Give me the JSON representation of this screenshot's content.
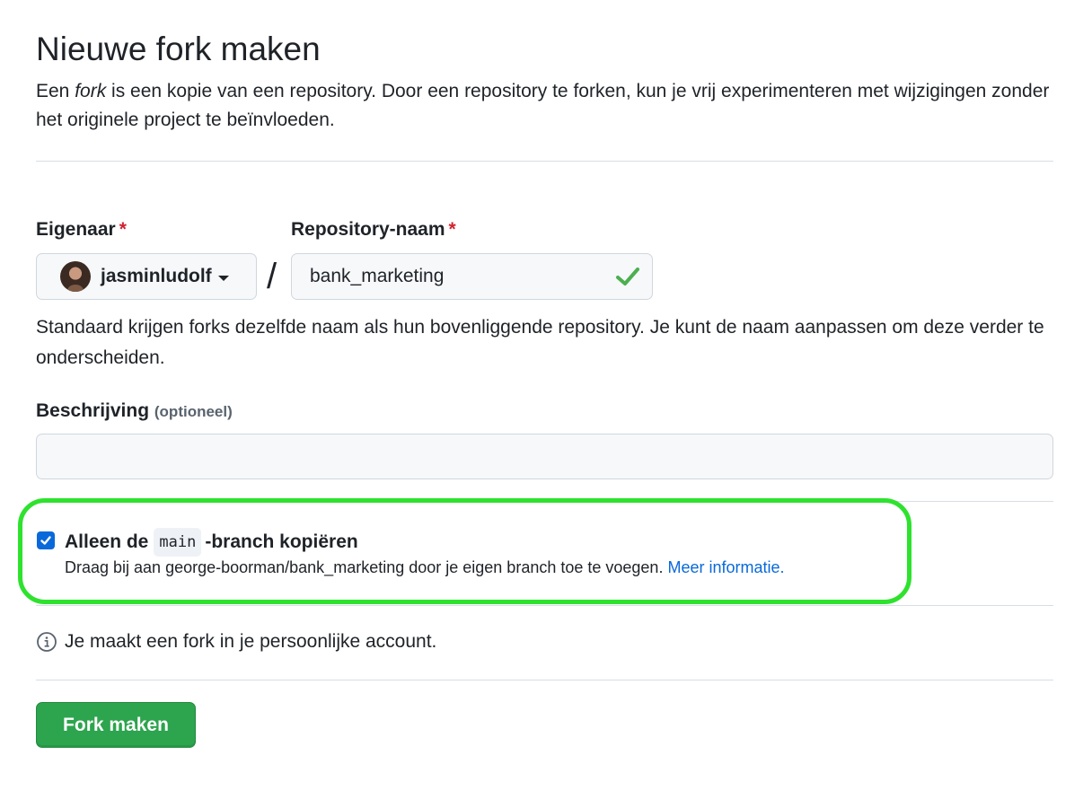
{
  "page": {
    "title": "Nieuwe fork maken",
    "intro_before": "Een ",
    "intro_em": "fork",
    "intro_after": " is een kopie van een repository. Door een repository te forken, kun je vrij experimenteren met wijzigingen zonder het originele project te beïnvloeden."
  },
  "owner": {
    "label": "Eigenaar",
    "required_mark": "*",
    "value": "jasminludolf",
    "avatar_icon": "user-avatar"
  },
  "separator": "/",
  "repository": {
    "label": "Repository-naam",
    "required_mark": "*",
    "value": "bank_marketing",
    "status_icon": "check-icon",
    "status_color": "#4caf50"
  },
  "name_hint": "Standaard krijgen forks dezelfde naam als hun bovenliggende repository. Je kunt de naam aanpassen om deze verder te onderscheiden.",
  "description": {
    "label": "Beschrijving",
    "optional": "(optioneel)",
    "value": "",
    "placeholder": ""
  },
  "copy_branch": {
    "checked": true,
    "label_before": "Alleen de",
    "branch": "main",
    "label_after": "-branch kopiëren",
    "help": "Draag bij aan george-boorman/bank_marketing door je eigen branch toe te voegen.",
    "link": "Meer informatie.",
    "highlight_color": "#2ee22e"
  },
  "info": {
    "icon": "info-icon",
    "text": "Je maakt een fork in je persoonlijke account."
  },
  "submit": {
    "label": "Fork maken",
    "color": "#2da44e"
  }
}
